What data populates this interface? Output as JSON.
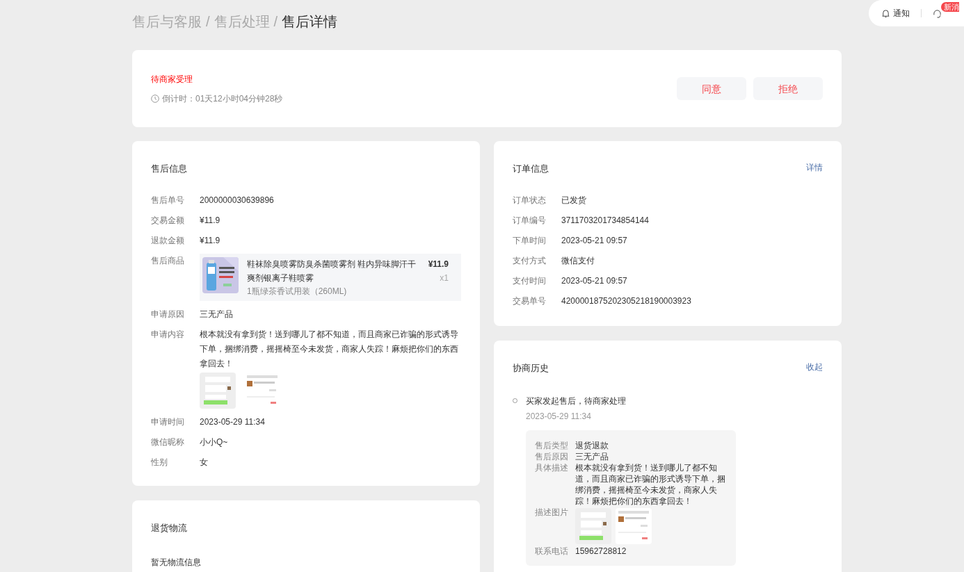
{
  "header": {
    "notify": "通知",
    "badge": "新消"
  },
  "breadcrumb_separator": "/",
  "breadcrumb": [
    {
      "label": "售后与客服",
      "current": false
    },
    {
      "label": "售后处理",
      "current": false
    },
    {
      "label": "售后详情",
      "current": true
    }
  ],
  "status": {
    "title": "待商家受理",
    "countdown": "倒计时：01天12小时04分钟28秒"
  },
  "actions": [
    "同意",
    "拒绝"
  ],
  "aftersale": {
    "title": "售后信息",
    "fields": [
      {
        "kind": "text",
        "label": "售后单号",
        "value": "2000000030639896"
      },
      {
        "kind": "text",
        "label": "交易金额",
        "value": "¥11.9"
      },
      {
        "kind": "text",
        "label": "退款金额",
        "value": "¥11.9"
      },
      {
        "kind": "product",
        "label": "售后商品",
        "name": "鞋袜除臭喷雾防臭杀菌喷雾剂 鞋内异味脚汗干爽剂银离子鞋喷雾",
        "spec": "1瓶绿茶香试用装（260ML)",
        "price": "¥11.9",
        "qty": "x1"
      },
      {
        "kind": "text",
        "label": "申请原因",
        "value": "三无产品"
      },
      {
        "kind": "content",
        "label": "申请内容",
        "value": "根本就没有拿到货！送到哪儿了都不知道，而且商家已诈骗的形式诱导下单，捆绑消费，摇摇椅至今未发货，商家人失踪！麻烦把你们的东西拿回去！"
      },
      {
        "kind": "text",
        "label": "申请时间",
        "value": "2023-05-29 11:34"
      },
      {
        "kind": "text",
        "label": "微信昵称",
        "value": "小小Q~"
      },
      {
        "kind": "text",
        "label": "性别",
        "value": "女"
      }
    ]
  },
  "logistics": {
    "title": "退货物流",
    "empty": "暂无物流信息"
  },
  "order": {
    "title": "订单信息",
    "link": "详情",
    "fields": [
      {
        "label": "订单状态",
        "value": "已发货"
      },
      {
        "label": "订单编号",
        "value": "3711703201734854144"
      },
      {
        "label": "下单时间",
        "value": "2023-05-21 09:57"
      },
      {
        "label": "支付方式",
        "value": "微信支付"
      },
      {
        "label": "支付时间",
        "value": "2023-05-21 09:57"
      },
      {
        "label": "交易单号",
        "value": "4200001875202305218190003923"
      }
    ]
  },
  "history": {
    "title": "协商历史",
    "link": "收起",
    "events": [
      {
        "title": "买家发起售后，待商家处理",
        "time": "2023-05-29 11:34",
        "details": [
          {
            "kind": "text",
            "label": "售后类型",
            "value": "退货退款"
          },
          {
            "kind": "text",
            "label": "售后原因",
            "value": "三无产品"
          },
          {
            "kind": "text",
            "label": "具体描述",
            "value": "根本就没有拿到货！送到哪儿了都不知道，而且商家已诈骗的形式诱导下单，捆绑消费，摇摇椅至今未发货，商家人失踪！麻烦把你们的东西拿回去！"
          },
          {
            "kind": "images",
            "label": "描述图片"
          },
          {
            "kind": "text",
            "label": "联系电话",
            "value": "15962728812"
          }
        ]
      }
    ]
  }
}
